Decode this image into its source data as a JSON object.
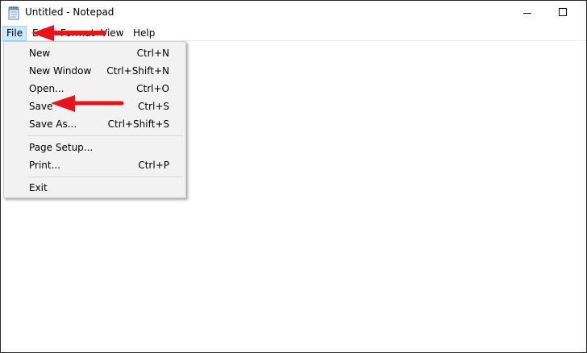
{
  "window": {
    "title": "Untitled - Notepad",
    "icon": "notepad-icon"
  },
  "title_controls": {
    "minimize_icon": "minimize-icon",
    "maximize_icon": "maximize-icon"
  },
  "menubar": {
    "items": [
      {
        "label": "File",
        "active": true
      },
      {
        "label": "Edit"
      },
      {
        "label": "Format"
      },
      {
        "label": "View"
      },
      {
        "label": "Help"
      }
    ]
  },
  "file_menu": {
    "items": [
      {
        "label": "New",
        "shortcut": "Ctrl+N"
      },
      {
        "label": "New Window",
        "shortcut": "Ctrl+Shift+N"
      },
      {
        "label": "Open...",
        "shortcut": "Ctrl+O"
      },
      {
        "label": "Save",
        "shortcut": "Ctrl+S"
      },
      {
        "label": "Save As...",
        "shortcut": "Ctrl+Shift+S"
      },
      {
        "label": "Page Setup...",
        "shortcut": ""
      },
      {
        "label": "Print...",
        "shortcut": "Ctrl+P"
      },
      {
        "label": "Exit",
        "shortcut": ""
      }
    ]
  },
  "annotations": {
    "arrow_color": "#e8141a",
    "arrows": [
      "points-to-file-menu",
      "points-to-save-item"
    ]
  },
  "colors": {
    "menu_highlight": "#cce8ff",
    "menu_bg": "#f2f2f2"
  }
}
